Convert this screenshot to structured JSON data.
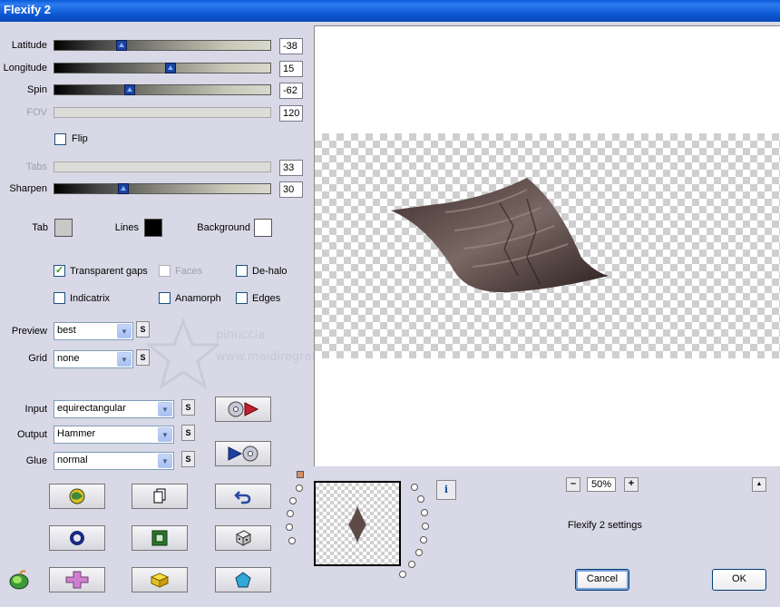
{
  "window": {
    "title": "Flexify 2"
  },
  "sliders": [
    {
      "label": "Latitude",
      "value": "-38",
      "position": 0.3,
      "disabled": false
    },
    {
      "label": "Longitude",
      "value": "15",
      "position": 0.54,
      "disabled": false
    },
    {
      "label": "Spin",
      "value": "-62",
      "position": 0.34,
      "disabled": false
    },
    {
      "label": "FOV",
      "value": "120",
      "disabled": true
    },
    {
      "label": "Tabs",
      "value": "33",
      "disabled": true
    },
    {
      "label": "Sharpen",
      "value": "30",
      "position": 0.31,
      "disabled": false
    }
  ],
  "flip": {
    "label": "Flip",
    "checked": false
  },
  "colors": {
    "tab": {
      "label": "Tab",
      "color": "#c8c8c8"
    },
    "lines": {
      "label": "Lines",
      "color": "#000000"
    },
    "background": {
      "label": "Background",
      "color": "#ffffff"
    }
  },
  "options": [
    {
      "label": "Transparent gaps",
      "checked": true,
      "disabled": false
    },
    {
      "label": "Faces",
      "checked": false,
      "disabled": true
    },
    {
      "label": "De-halo",
      "checked": false,
      "disabled": false
    },
    {
      "label": "Indicatrix",
      "checked": false,
      "disabled": false
    },
    {
      "label": "Anamorph",
      "checked": false,
      "disabled": false
    },
    {
      "label": "Edges",
      "checked": false,
      "disabled": false
    }
  ],
  "preview": {
    "label": "Preview",
    "value": "best"
  },
  "grid": {
    "label": "Grid",
    "value": "none"
  },
  "input": {
    "label": "Input",
    "value": "equirectangular"
  },
  "output": {
    "label": "Output",
    "value": "Hammer"
  },
  "glue": {
    "label": "Glue",
    "value": "normal"
  },
  "s_button_label": "S",
  "zoom": {
    "value": "50%",
    "minus": "–",
    "plus": "+"
  },
  "info_icon": "i",
  "up_icon": "▲",
  "status_text": "Flexify 2 settings",
  "buttons": {
    "cancel": "Cancel",
    "ok": "OK"
  },
  "watermark": {
    "line1": "pinuccia",
    "line2": "www.maidiregrafica.eu"
  },
  "accent_colors": {
    "title_bar": "#0a55d0",
    "check_mark": "#21a121",
    "shape": "#5e4b48"
  }
}
